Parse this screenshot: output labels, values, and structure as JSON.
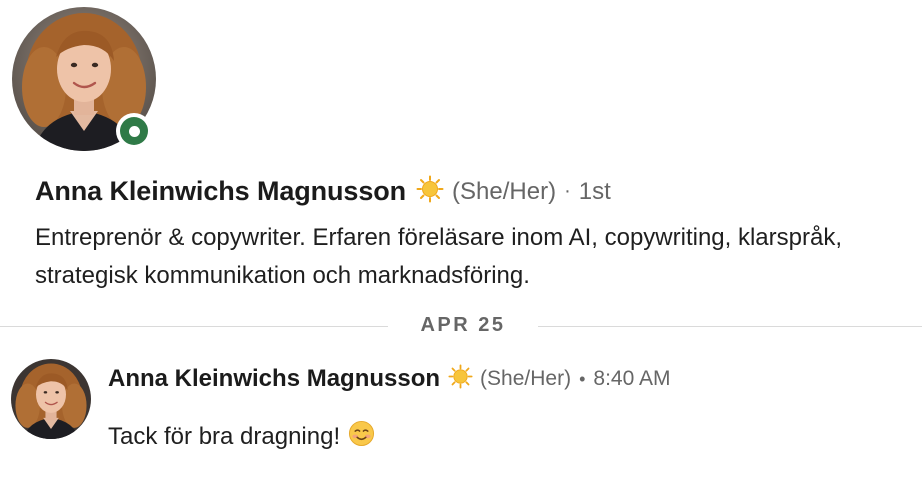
{
  "profile": {
    "name": "Anna Kleinwichs Magnusson",
    "pronouns": "(She/Her)",
    "separator": "·",
    "connection_degree": "1st",
    "headline": "Entreprenör & copywriter. Erfaren föreläsare inom AI, copywriting, klarspråk, strategisk kommunikation och marknadsföring.",
    "name_emoji": "sun-icon",
    "status": "online",
    "status_color": "#2f7a47"
  },
  "divider": {
    "date": "APR 25"
  },
  "message": {
    "sender": "Anna Kleinwichs Magnusson",
    "pronouns": "(She/Her)",
    "separator": "•",
    "time": "8:40 AM",
    "text": "Tack för bra dragning!",
    "emoji": "smiling-face-icon"
  },
  "colors": {
    "text": "#1f1f1f",
    "muted": "#666666",
    "divider": "#dadada",
    "online": "#2f7a47"
  }
}
